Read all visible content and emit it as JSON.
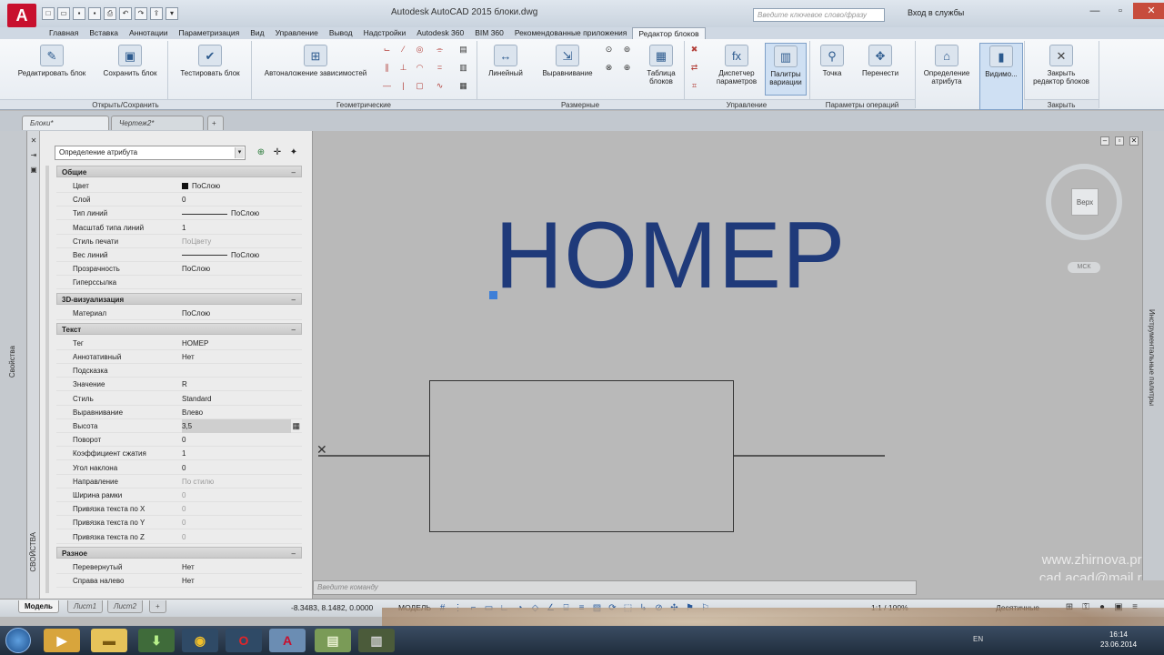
{
  "titlebar": {
    "app_logo": "A",
    "title": "Autodesk AutoCAD 2015    блоки.dwg",
    "search_placeholder": "Введите ключевое слово/фразу",
    "login": "Вход в службы",
    "min": "—",
    "max": "▫",
    "close": "✕"
  },
  "ribbon_tabs": [
    "Главная",
    "Вставка",
    "Аннотации",
    "Параметризация",
    "Вид",
    "Управление",
    "Вывод",
    "Надстройки",
    "Autodesk 360",
    "BIM 360",
    "Рекомендованные приложения",
    "Редактор блоков"
  ],
  "ribbon": {
    "btn_edit_block": "Редактировать блок",
    "btn_save_block": "Сохранить блок",
    "btn_test_block": "Тестировать блок",
    "btn_auto_constraints": "Автоналожение зависимостей",
    "btn_linear": "Линейный",
    "btn_align": "Выравнивание",
    "btn_block_table_1": "Таблица",
    "btn_block_table_2": "блоков",
    "btn_param_manager_1": "Диспетчер",
    "btn_param_manager_2": "параметров",
    "btn_palettes_1": "Палитры",
    "btn_palettes_2": "вариации",
    "btn_point": "Точка",
    "btn_move": "Перенести",
    "btn_attr_def_1": "Определение",
    "btn_attr_def_2": "атрибута",
    "btn_visibility": "Видимо...",
    "btn_close_1": "Закрыть",
    "btn_close_2": "редактор блоков",
    "panel_open_save": "Открыть/Сохранить",
    "panel_geometric": "Геометрические",
    "panel_dimensional": "Размерные",
    "panel_manage": "Управление",
    "panel_action_params": "Параметры операций",
    "panel_close": "Закрыть"
  },
  "doc_tabs": [
    "Блоки*",
    "Чертеж2*",
    "+"
  ],
  "left_strip": {
    "label": "Свойства"
  },
  "palette": {
    "vertical_label": "СВОЙСТВА",
    "object_type": "Определение атрибута",
    "sections": {
      "general": "Общие",
      "viz3d": "3D-визуализация",
      "text": "Текст",
      "misc": "Разное"
    },
    "general_rows": [
      {
        "k": "Цвет",
        "v": "ПоСлою"
      },
      {
        "k": "Слой",
        "v": "0"
      },
      {
        "k": "Тип линий",
        "v": "ПоСлою"
      },
      {
        "k": "Масштаб типа линий",
        "v": "1"
      },
      {
        "k": "Стиль печати",
        "v": "ПоЦвету"
      },
      {
        "k": "Вес линий",
        "v": "ПоСлою"
      },
      {
        "k": "Прозрачность",
        "v": "ПоСлою"
      },
      {
        "k": "Гиперссылка",
        "v": ""
      }
    ],
    "viz_rows": [
      {
        "k": "Материал",
        "v": "ПоСлою"
      }
    ],
    "text_rows": [
      {
        "k": "Тег",
        "v": "НОМЕР"
      },
      {
        "k": "Аннотативный",
        "v": "Нет"
      },
      {
        "k": "Подсказка",
        "v": ""
      },
      {
        "k": "Значение",
        "v": "R"
      },
      {
        "k": "Стиль",
        "v": "Standard"
      },
      {
        "k": "Выравнивание",
        "v": "Влево"
      },
      {
        "k": "Высота",
        "v": "3,5"
      },
      {
        "k": "Поворот",
        "v": "0"
      },
      {
        "k": "Коэффициент сжатия",
        "v": "1"
      },
      {
        "k": "Угол наклона",
        "v": "0"
      },
      {
        "k": "Направление",
        "v": "По стилю"
      },
      {
        "k": "Ширина рамки",
        "v": "0"
      },
      {
        "k": "Привязка текста по X",
        "v": "0"
      },
      {
        "k": "Привязка текста по Y",
        "v": "0"
      },
      {
        "k": "Привязка текста по Z",
        "v": "0"
      }
    ],
    "misc_rows": [
      {
        "k": "Перевернутый",
        "v": "Нет"
      },
      {
        "k": "Справа налево",
        "v": "Нет"
      }
    ]
  },
  "canvas": {
    "attribute_tag": "НОМЕР",
    "viewcube_face": "Верх",
    "wcs": "МСК",
    "watermark_line1": "www.zhirnova.pro",
    "watermark_line2": "cad.acad@mail.ru"
  },
  "right_strip": {
    "label": "Инструментальные палитры"
  },
  "command_line": {
    "placeholder": "Введите команду"
  },
  "status": {
    "layout_tabs": [
      "Модель",
      "Лист1",
      "Лист2",
      "+"
    ],
    "coords": "-8.3483, 8.1482, 0.0000",
    "model": "МОДЕЛЬ",
    "scale": "1:1 / 100%",
    "units": "Десятичные"
  },
  "taskbar": {
    "lang": "EN",
    "time": "16:14",
    "date": "23.06.2014"
  },
  "colors": {
    "accent": "#1f3a7a",
    "autocad_red": "#c8102e",
    "grip": "#3e7fd7"
  }
}
